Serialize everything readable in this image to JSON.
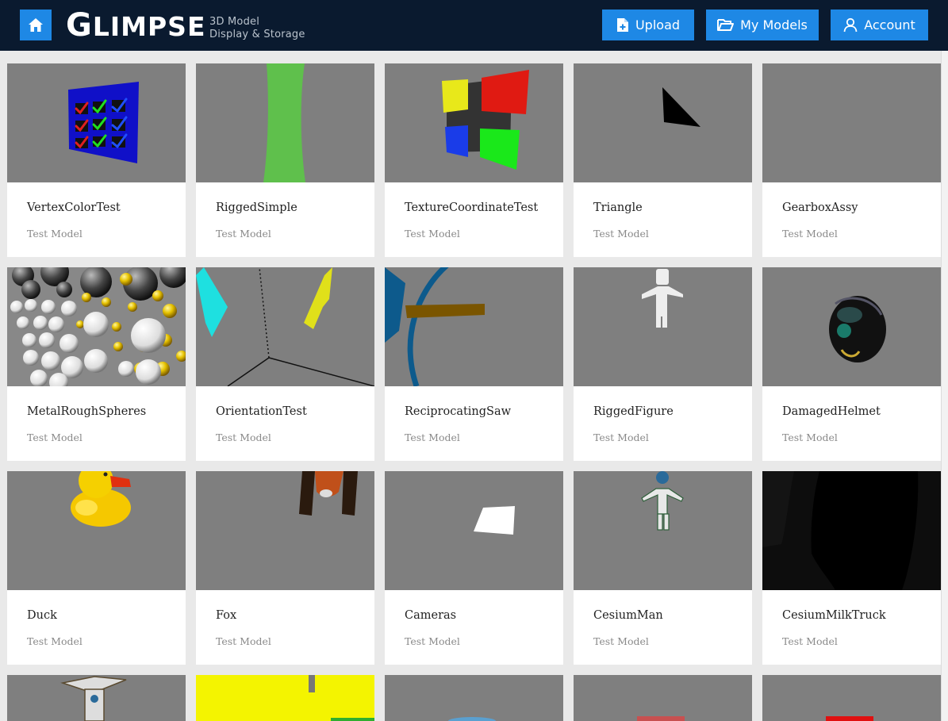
{
  "header": {
    "logo_big_g": "G",
    "logo_rest": "LIMPSE",
    "tagline_line1": "3D Model",
    "tagline_line2": "Display & Storage",
    "upload_label": "Upload",
    "my_models_label": "My Models",
    "account_label": "Account",
    "accent_color": "#1e88e5",
    "bar_color": "#0a1a2f"
  },
  "models": [
    {
      "title": "VertexColorTest",
      "subtitle": "Test Model"
    },
    {
      "title": "RiggedSimple",
      "subtitle": "Test Model"
    },
    {
      "title": "TextureCoordinateTest",
      "subtitle": "Test Model"
    },
    {
      "title": "Triangle",
      "subtitle": "Test Model"
    },
    {
      "title": "GearboxAssy",
      "subtitle": "Test Model"
    },
    {
      "title": "MetalRoughSpheres",
      "subtitle": "Test Model"
    },
    {
      "title": "OrientationTest",
      "subtitle": "Test Model"
    },
    {
      "title": "ReciprocatingSaw",
      "subtitle": "Test Model"
    },
    {
      "title": "RiggedFigure",
      "subtitle": "Test Model"
    },
    {
      "title": "DamagedHelmet",
      "subtitle": "Test Model"
    },
    {
      "title": "Duck",
      "subtitle": "Test Model"
    },
    {
      "title": "Fox",
      "subtitle": "Test Model"
    },
    {
      "title": "Cameras",
      "subtitle": "Test Model"
    },
    {
      "title": "CesiumMan",
      "subtitle": "Test Model"
    },
    {
      "title": "CesiumMilkTruck",
      "subtitle": "Test Model"
    }
  ]
}
